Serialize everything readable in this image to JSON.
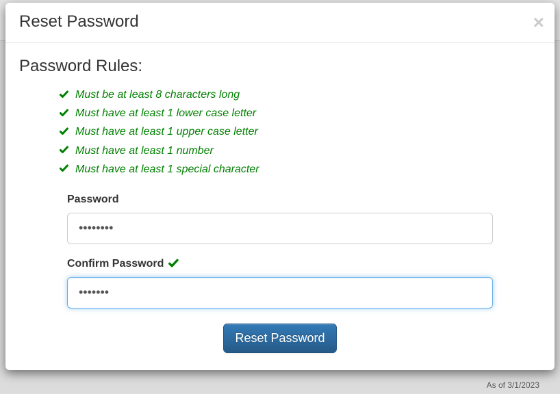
{
  "modal": {
    "title": "Reset Password",
    "close_label": "×"
  },
  "rules": {
    "heading": "Password Rules:",
    "items": [
      "Must be at least 8 characters long",
      "Must have at least 1 lower case letter",
      "Must have at least 1 upper case letter",
      "Must have at least 1 number",
      "Must have at least 1 special character"
    ]
  },
  "form": {
    "password_label": "Password",
    "password_value": "••••••••",
    "confirm_label": "Confirm Password",
    "confirm_value": "•••••••",
    "submit_label": "Reset Password"
  },
  "colors": {
    "valid": "green",
    "primary": "#337ab7"
  },
  "bg": {
    "asof": "As of 3/1/2023"
  }
}
